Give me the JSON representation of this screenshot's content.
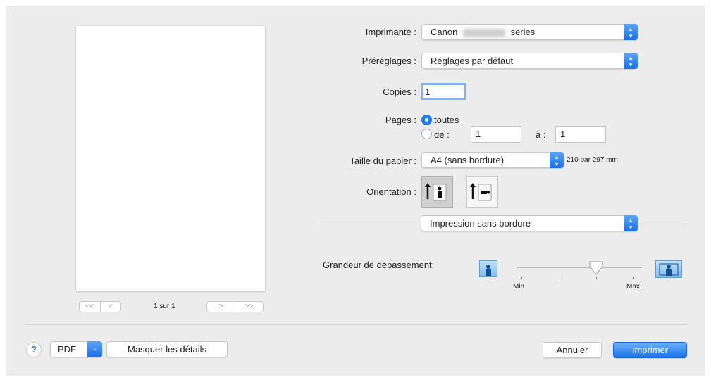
{
  "preview": {
    "page_indicator": "1 sur 1",
    "nav": {
      "first": "<<",
      "prev": "<",
      "next": ">",
      "last": ">>"
    }
  },
  "printer": {
    "label": "Imprimante :",
    "value_prefix": "Canon",
    "value_suffix": "series"
  },
  "presets": {
    "label": "Préréglages :",
    "value": "Réglages par défaut"
  },
  "copies": {
    "label": "Copies :",
    "value": "1"
  },
  "pages": {
    "label": "Pages :",
    "all_label": "toutes",
    "from_label": "de :",
    "from_value": "1",
    "to_label": "à :",
    "to_value": "1",
    "selected": "toutes"
  },
  "paper": {
    "label": "Taille du papier :",
    "value": "A4 (sans bordure)",
    "dimensions": "210 par 297 mm"
  },
  "orientation": {
    "label": "Orientation :",
    "selected": "portrait"
  },
  "section": {
    "value": "Impression sans bordure"
  },
  "overflow": {
    "label": "Grandeur de dépassement:",
    "min_label": "Min",
    "max_label": "Max",
    "value_step": 3,
    "steps": 4
  },
  "footer": {
    "help": "?",
    "pdf": "PDF",
    "details": "Masquer les détails",
    "cancel": "Annuler",
    "print": "Imprimer"
  },
  "colors": {
    "accent": "#1f7ef0"
  }
}
